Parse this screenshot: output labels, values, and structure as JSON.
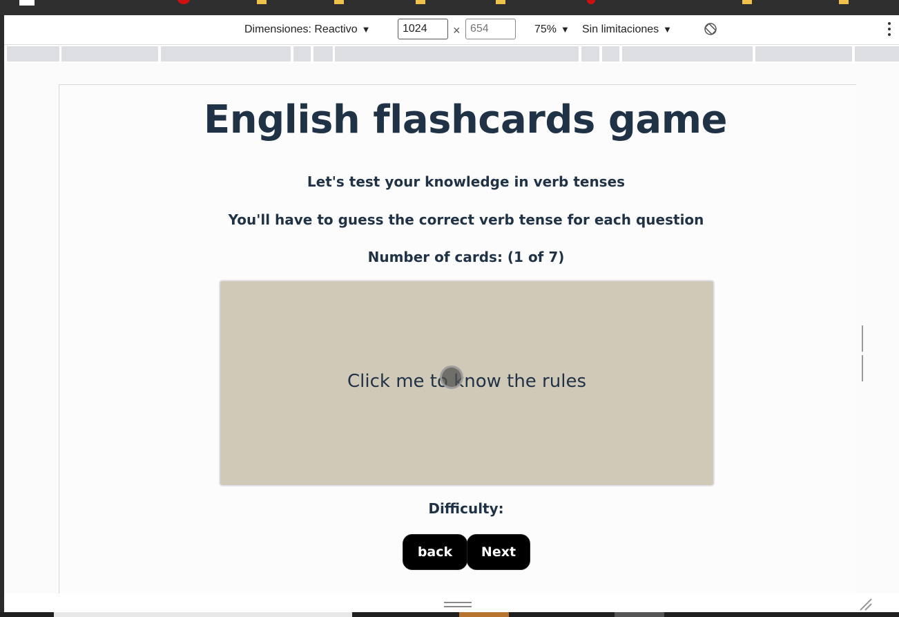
{
  "devtools": {
    "dimensions_label": "Dimensiones: Reactivo",
    "width_value": "1024",
    "height_placeholder": "654",
    "times_symbol": "×",
    "zoom": "75%",
    "throttling": "Sin limitaciones",
    "caret": "▼",
    "rotate_icon": "rotate-icon",
    "more_icon": "kebab-menu-icon"
  },
  "page": {
    "title": "English flashcards game",
    "intro": "Let's test your knowledge in verb tenses",
    "instructions": "You'll have to guess the correct verb tense for each question",
    "card_count": "Number of cards: (1 of 7)",
    "card_text": "Click me to know the rules",
    "difficulty_label": "Difficulty:",
    "back_label": "back",
    "next_label": "Next"
  },
  "colors": {
    "heading": "#1f3246",
    "card_background": "#d1c9b8",
    "button_background": "#000000",
    "button_text": "#ffffff"
  }
}
